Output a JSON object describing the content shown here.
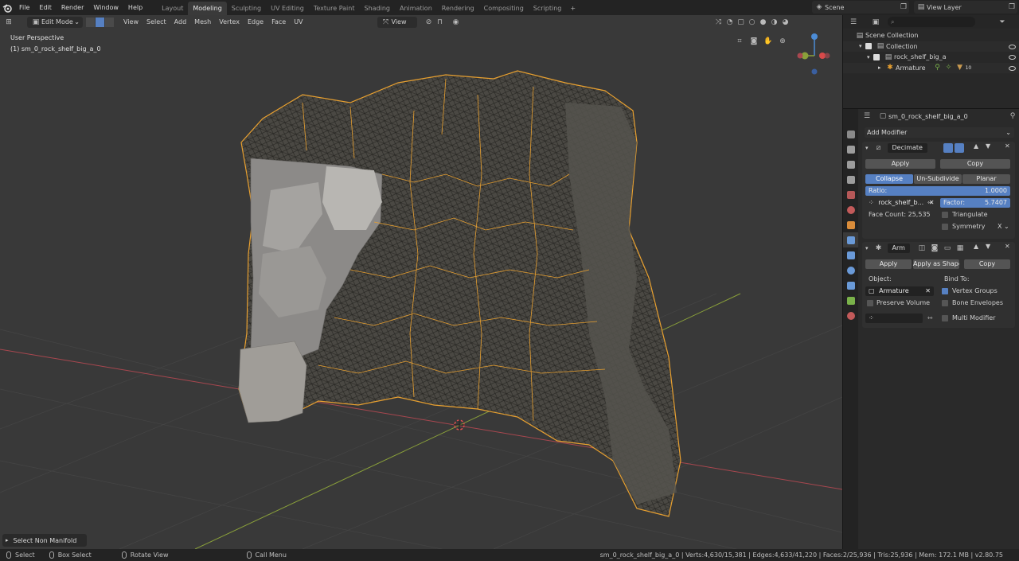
{
  "menu": [
    "File",
    "Edit",
    "Render",
    "Window",
    "Help"
  ],
  "tabs": [
    "Layout",
    "Modeling",
    "Sculpting",
    "UV Editing",
    "Texture Paint",
    "Shading",
    "Animation",
    "Rendering",
    "Compositing",
    "Scripting"
  ],
  "active_tab": "Modeling",
  "scene_name": "Scene",
  "view_layer": "View Layer",
  "viewport": {
    "mode": "Edit Mode",
    "header_menu": [
      "View",
      "Select",
      "Add",
      "Mesh",
      "Vertex",
      "Edge",
      "Face",
      "UV"
    ],
    "orientation": "View",
    "info_line1": "User Perspective",
    "info_line2": "(1) sm_0_rock_shelf_big_a_0",
    "last_operator": "Select Non Manifold"
  },
  "outliner": {
    "rows": [
      {
        "label": "Scene Collection",
        "icon": "collection-icon"
      },
      {
        "label": "Collection",
        "icon": "collection-icon"
      },
      {
        "label": "rock_shelf_big_a",
        "icon": "object-icon"
      },
      {
        "label": "Armature",
        "icon": "armature-icon"
      }
    ],
    "badge_count": "10"
  },
  "properties": {
    "object_name": "sm_0_rock_shelf_big_a_0",
    "add_modifier": "Add Modifier",
    "decimate": {
      "name": "Decimate",
      "apply": "Apply",
      "copy": "Copy",
      "modes": [
        "Collapse",
        "Un-Subdivide",
        "Planar"
      ],
      "active_mode": "Collapse",
      "ratio_label": "Ratio:",
      "ratio_value": "1.0000",
      "vgroup_name": "rock_shelf_b...",
      "factor_label": "Factor:",
      "factor_value": "5.7407",
      "face_count": "Face Count: 25,535",
      "triangulate": "Triangulate",
      "symmetry": "Symmetry",
      "symmetry_axis": "X"
    },
    "armature_mod": {
      "name": "Arm",
      "apply": "Apply",
      "apply_shape": "Apply as Shape...",
      "copy": "Copy",
      "object_label": "Object:",
      "object_value": "Armature",
      "bind_to": "Bind To:",
      "vertex_groups": "Vertex Groups",
      "preserve_volume": "Preserve Volume",
      "bone_envelopes": "Bone Envelopes",
      "multi_modifier": "Multi Modifier"
    }
  },
  "statusbar": {
    "select": "Select",
    "box_select": "Box Select",
    "rotate_view": "Rotate View",
    "call_menu": "Call Menu",
    "stats": "sm_0_rock_shelf_big_a_0 | Verts:4,630/15,381 | Edges:4,633/41,220 | Faces:2/25,936 | Tris:25,936 | Mem: 172.1 MB | v2.80.75"
  },
  "colors": {
    "accent": "#5680c2",
    "selection_edges": "#e8a030",
    "grid_x_axis": "#a8474f",
    "grid_y_axis": "#8aa03a"
  }
}
